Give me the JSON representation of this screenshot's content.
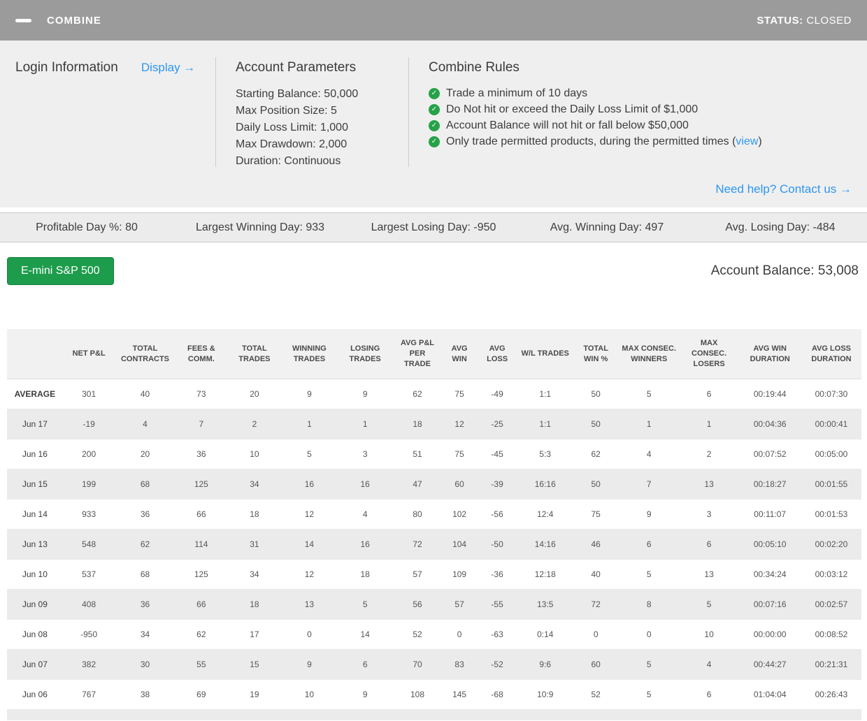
{
  "colors": {
    "accent_blue": "#2e96f0",
    "button_green": "#1d9c4c",
    "check_green": "#26a248",
    "topbar_gray": "#9b9b9b"
  },
  "header": {
    "title": "COMBINE",
    "status_label": "STATUS:",
    "status_value": "CLOSED"
  },
  "panel": {
    "login_title": "Login Information",
    "display_link": "Display →",
    "params_title": "Account Parameters",
    "params": [
      "Starting Balance: 50,000",
      "Max Position Size: 5",
      "Daily Loss Limit: 1,000",
      "Max Drawdown: 2,000",
      "Duration: Continuous"
    ],
    "rules_title": "Combine Rules",
    "rules": [
      {
        "text": "Trade a minimum of 10 days"
      },
      {
        "text": "Do Not hit or exceed the Daily Loss Limit of $1,000"
      },
      {
        "text": "Account Balance will not hit or fall below $50,000"
      },
      {
        "text": "Only trade permitted products, during the permitted times",
        "link": "view"
      }
    ],
    "help_link": "Need help? Contact us →"
  },
  "stats": [
    "Profitable Day %: 80",
    "Largest Winning Day: 933",
    "Largest Losing Day: -950",
    "Avg. Winning Day: 497",
    "Avg. Losing Day: -484"
  ],
  "account": {
    "product": "E-mini S&P 500",
    "balance": "Account Balance: 53,008"
  },
  "table": {
    "columns": [
      "",
      "NET P&L",
      "TOTAL CONTRACTS",
      "FEES & COMM.",
      "TOTAL TRADES",
      "WINNING TRADES",
      "LOSING TRADES",
      "AVG P&L PER TRADE",
      "AVG WIN",
      "AVG LOSS",
      "W/L TRADES",
      "TOTAL WIN %",
      "MAX CONSEC. WINNERS",
      "MAX CONSEC. LOSERS",
      "AVG WIN DURATION",
      "AVG LOSS DURATION"
    ],
    "rows": [
      {
        "label": "AVERAGE",
        "bold": true,
        "values": [
          "301",
          "40",
          "73",
          "20",
          "9",
          "9",
          "62",
          "75",
          "-49",
          "1:1",
          "50",
          "5",
          "6",
          "00:19:44",
          "00:07:30"
        ]
      },
      {
        "label": "Jun 17",
        "values": [
          "-19",
          "4",
          "7",
          "2",
          "1",
          "1",
          "18",
          "12",
          "-25",
          "1:1",
          "50",
          "1",
          "1",
          "00:04:36",
          "00:00:41"
        ]
      },
      {
        "label": "Jun 16",
        "values": [
          "200",
          "20",
          "36",
          "10",
          "5",
          "3",
          "51",
          "75",
          "-45",
          "5:3",
          "62",
          "4",
          "2",
          "00:07:52",
          "00:05:00"
        ]
      },
      {
        "label": "Jun 15",
        "values": [
          "199",
          "68",
          "125",
          "34",
          "16",
          "16",
          "47",
          "60",
          "-39",
          "16:16",
          "50",
          "7",
          "13",
          "00:18:27",
          "00:01:55"
        ]
      },
      {
        "label": "Jun 14",
        "values": [
          "933",
          "36",
          "66",
          "18",
          "12",
          "4",
          "80",
          "102",
          "-56",
          "12:4",
          "75",
          "9",
          "3",
          "00:11:07",
          "00:01:53"
        ]
      },
      {
        "label": "Jun 13",
        "values": [
          "548",
          "62",
          "114",
          "31",
          "14",
          "16",
          "72",
          "104",
          "-50",
          "14:16",
          "46",
          "6",
          "6",
          "00:05:10",
          "00:02:20"
        ]
      },
      {
        "label": "Jun 10",
        "values": [
          "537",
          "68",
          "125",
          "34",
          "12",
          "18",
          "57",
          "109",
          "-36",
          "12:18",
          "40",
          "5",
          "13",
          "00:34:24",
          "00:03:12"
        ]
      },
      {
        "label": "Jun 09",
        "values": [
          "408",
          "36",
          "66",
          "18",
          "13",
          "5",
          "56",
          "57",
          "-55",
          "13:5",
          "72",
          "8",
          "5",
          "00:07:16",
          "00:02:57"
        ]
      },
      {
        "label": "Jun 08",
        "values": [
          "-950",
          "34",
          "62",
          "17",
          "0",
          "14",
          "52",
          "0",
          "-63",
          "0:14",
          "0",
          "0",
          "10",
          "00:00:00",
          "00:08:52"
        ]
      },
      {
        "label": "Jun 07",
        "values": [
          "382",
          "30",
          "55",
          "15",
          "9",
          "6",
          "70",
          "83",
          "-52",
          "9:6",
          "60",
          "5",
          "4",
          "00:44:27",
          "00:21:31"
        ]
      },
      {
        "label": "Jun 06",
        "values": [
          "767",
          "38",
          "69",
          "19",
          "10",
          "9",
          "108",
          "145",
          "-68",
          "10:9",
          "52",
          "5",
          "6",
          "01:04:04",
          "00:26:43"
        ]
      }
    ]
  }
}
